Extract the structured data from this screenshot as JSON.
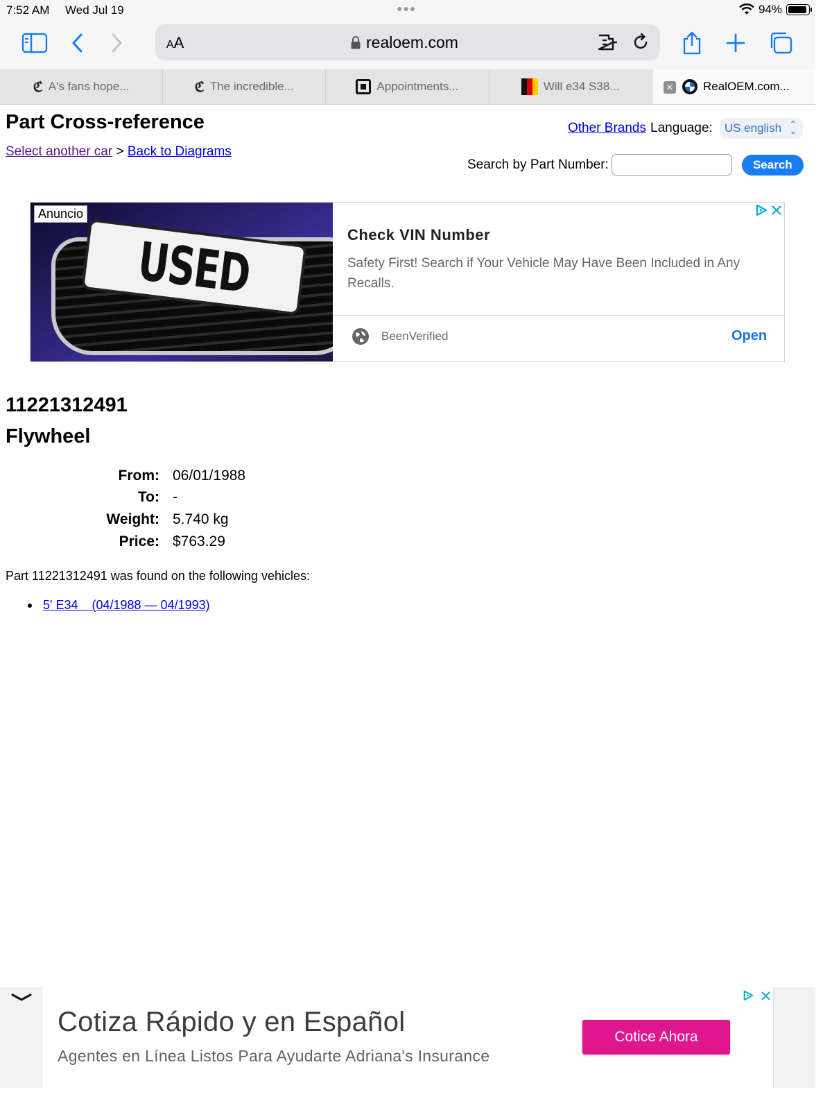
{
  "status_bar": {
    "time": "7:52 AM",
    "date": "Wed Jul 19",
    "battery": "94%",
    "battery_level": 0.94
  },
  "browser": {
    "address": {
      "aa_small": "A",
      "aa_large": "A",
      "url": "realoem.com"
    },
    "tabs": [
      {
        "title": "A's fans hope...",
        "favicon": "newspaper-c-icon"
      },
      {
        "title": "The incredible...",
        "favicon": "newspaper-c-icon"
      },
      {
        "title": "Appointments...",
        "favicon": "square-icon"
      },
      {
        "title": "Will e34 S38...",
        "favicon": "german-flag-icon"
      },
      {
        "title": "RealOEM.com...",
        "favicon": "bmw-logo-icon",
        "active": true
      }
    ]
  },
  "header": {
    "title": "Part Cross-reference",
    "breadcrumb": {
      "select_car": "Select another car",
      "separator": ">",
      "back": "Back to Diagrams"
    },
    "other_brands": "Other Brands",
    "language_label": "Language:",
    "language_value": "US english",
    "search_label": "Search by Part Number:",
    "search_value": "",
    "search_button": "Search"
  },
  "ad": {
    "badge": "Anuncio",
    "plate_text": "USED",
    "headline": "Check VIN Number",
    "description": "Safety First! Search if Your Vehicle May Have Been Included in Any Recalls.",
    "advertiser": "BeenVerified",
    "cta": "Open"
  },
  "part": {
    "number": "11221312491",
    "name": "Flywheel",
    "specs": [
      {
        "label": "From:",
        "value": "06/01/1988"
      },
      {
        "label": "To:",
        "value": "-"
      },
      {
        "label": "Weight:",
        "value": "5.740 kg"
      },
      {
        "label": "Price:",
        "value": "$763.29"
      }
    ],
    "found_text": "Part 11221312491 was found on the following vehicles:",
    "vehicles": [
      {
        "label": "5' E34    (04/1988 — 04/1993)"
      }
    ]
  },
  "bottom_ad": {
    "headline": "Cotiza Rápido y en Español",
    "description": "Agentes en Línea Listos Para Ayudarte Adriana's Insurance",
    "cta": "Cotice Ahora"
  },
  "colors": {
    "link": "#0000ee",
    "visited": "#551a8b",
    "primary_button": "#1a7cf2",
    "ad_cta": "#e0168f",
    "ad_open": "#1a73e8"
  }
}
